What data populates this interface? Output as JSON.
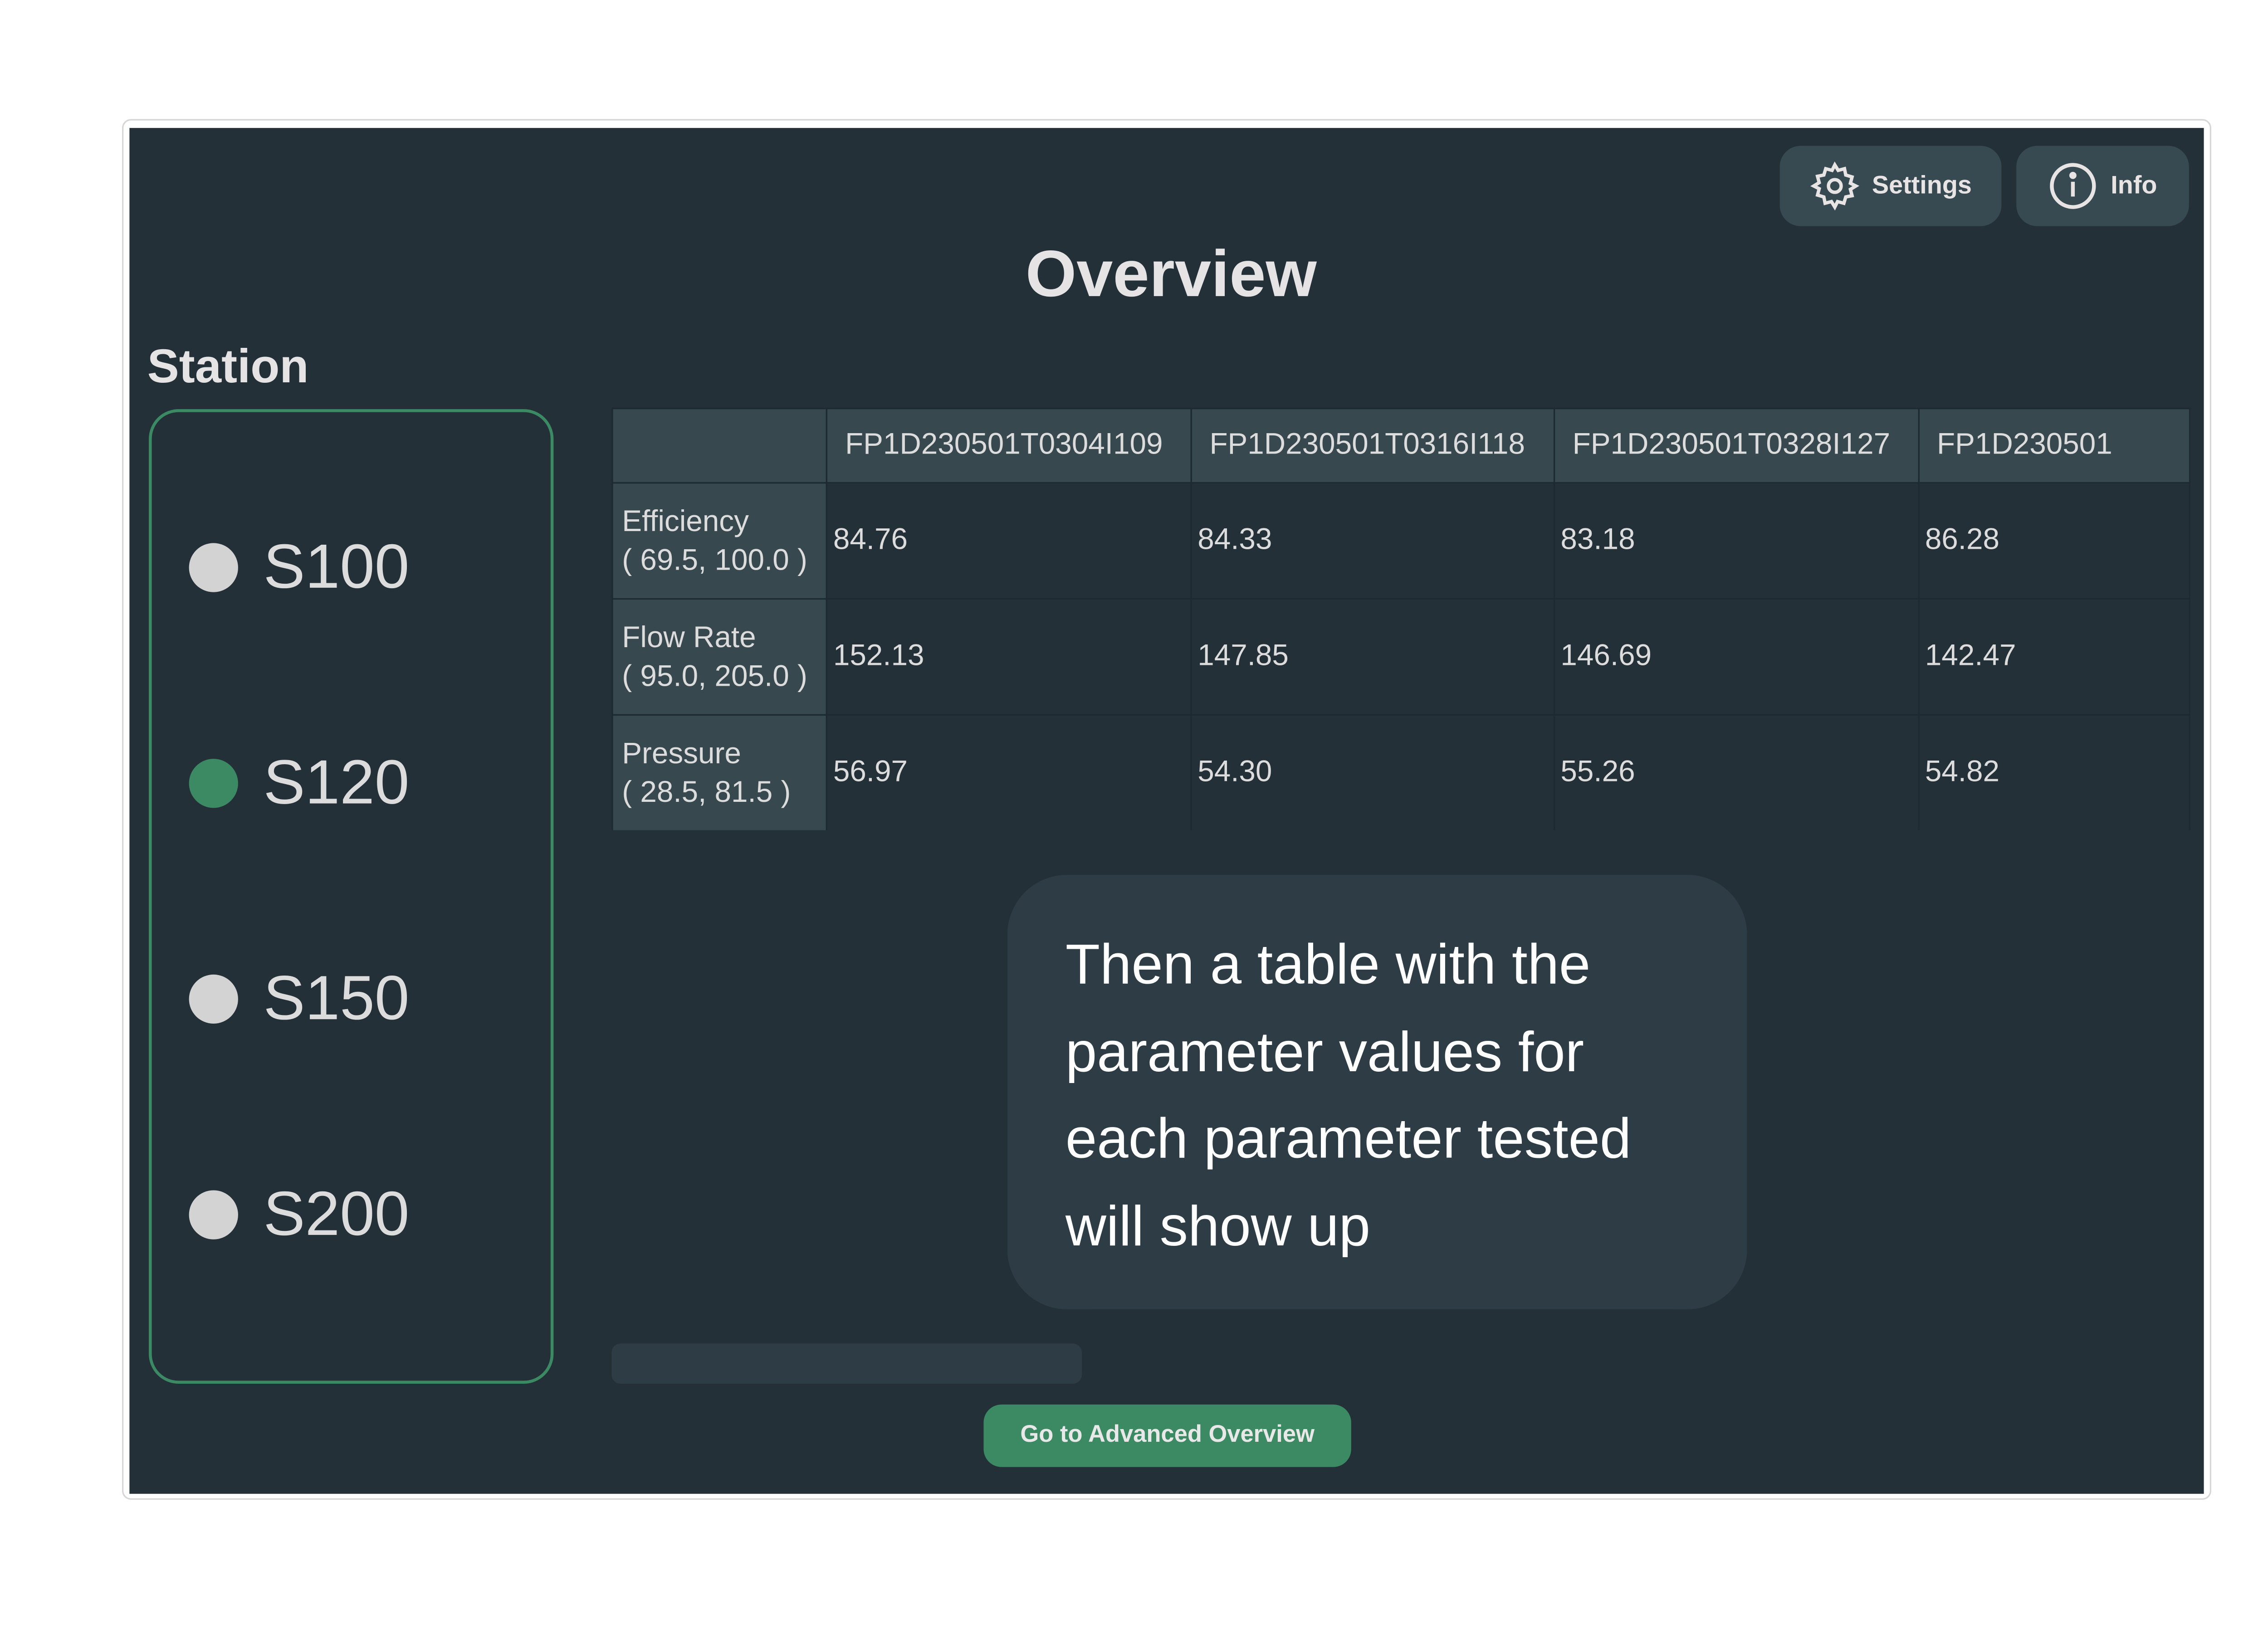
{
  "header": {
    "title": "Overview",
    "settings_label": "Settings",
    "info_label": "Info"
  },
  "station": {
    "heading": "Station",
    "items": [
      {
        "label": "S100",
        "status_color": "#d3d3d3"
      },
      {
        "label": "S120",
        "status_color": "#3b8a63"
      },
      {
        "label": "S150",
        "status_color": "#d3d3d3"
      },
      {
        "label": "S200",
        "status_color": "#d3d3d3"
      }
    ]
  },
  "table": {
    "columns": [
      "FP1D230501T0304I109",
      "FP1D230501T0316I118",
      "FP1D230501T0328I127",
      "FP1D230501"
    ],
    "rows": [
      {
        "name": "Efficiency",
        "range": "( 69.5, 100.0 )",
        "values": [
          "84.76",
          "84.33",
          "83.18",
          "86.28"
        ]
      },
      {
        "name": "Flow Rate",
        "range": "( 95.0, 205.0 )",
        "values": [
          "152.13",
          "147.85",
          "146.69",
          "142.47"
        ]
      },
      {
        "name": "Pressure",
        "range": "( 28.5, 81.5 )",
        "values": [
          "56.97",
          "54.30",
          "55.26",
          "54.82"
        ]
      }
    ]
  },
  "tooltip": {
    "text": "Then a table with the parameter values for each parameter tested will show up"
  },
  "footer": {
    "advanced_button": "Go to Advanced Overview"
  }
}
